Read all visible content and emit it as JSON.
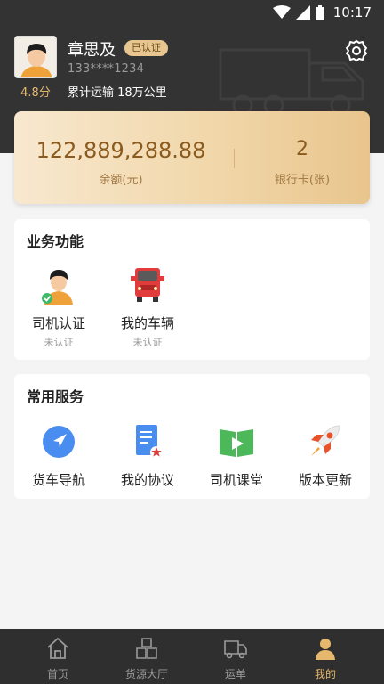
{
  "status_bar": {
    "time": "10:17"
  },
  "profile": {
    "name": "章思及",
    "cert_badge": "已认证",
    "phone": "133****1234",
    "score": "4.8分",
    "mileage": "累计运输 18万公里"
  },
  "balance": {
    "amount": "122,889,288.88",
    "amount_label": "余额(元)",
    "card_count": "2",
    "card_label": "银行卡(张)"
  },
  "business": {
    "title": "业务功能",
    "items": [
      {
        "label": "司机认证",
        "sub": "未认证",
        "icon": "driver-cert-icon"
      },
      {
        "label": "我的车辆",
        "sub": "未认证",
        "icon": "truck-icon"
      }
    ]
  },
  "services": {
    "title": "常用服务",
    "items": [
      {
        "label": "货车导航",
        "icon": "navigation-icon"
      },
      {
        "label": "我的协议",
        "icon": "agreement-icon"
      },
      {
        "label": "司机课堂",
        "icon": "classroom-icon"
      },
      {
        "label": "版本更新",
        "icon": "rocket-icon"
      }
    ]
  },
  "tabs": [
    {
      "label": "首页",
      "icon": "home-icon"
    },
    {
      "label": "货源大厅",
      "icon": "boxes-icon"
    },
    {
      "label": "运单",
      "icon": "truck-icon"
    },
    {
      "label": "我的",
      "icon": "person-icon",
      "active": true
    }
  ],
  "colors": {
    "header_bg": "#333333",
    "gold": "#e6b86e",
    "tabbar_bg": "#2f2f2f"
  }
}
